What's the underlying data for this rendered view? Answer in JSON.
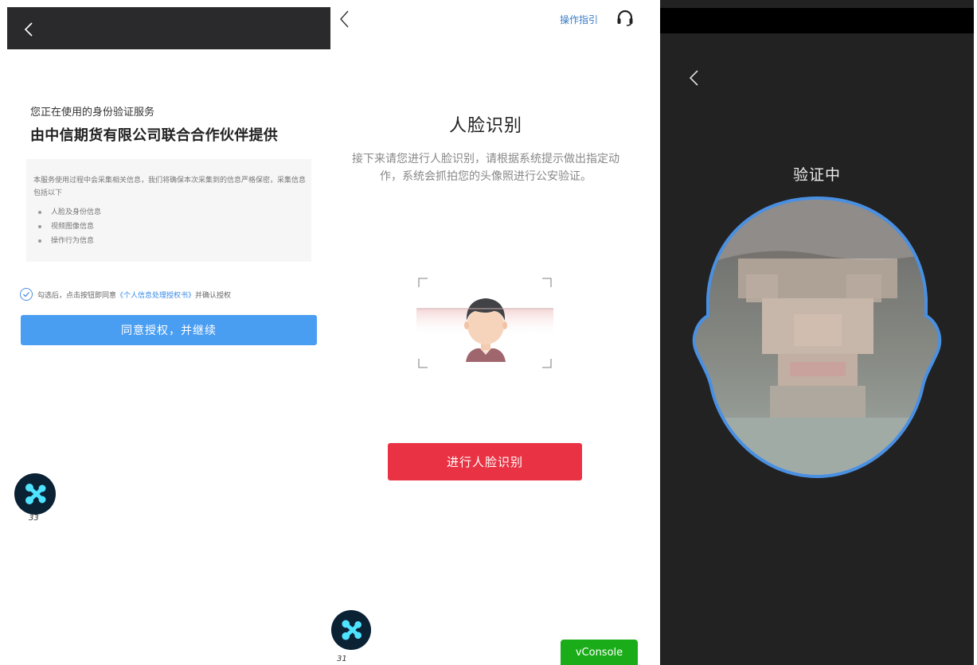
{
  "panel1": {
    "subtitle": "您正在使用的身份验证服务",
    "title": "由中信期货有限公司联合合作伙伴提供",
    "info_intro": "本服务使用过程中会采集相关信息，我们将确保本次采集到的信息严格保密，采集信息包括以下",
    "bullets": [
      "人脸及身份信息",
      "视频图像信息",
      "操作行为信息"
    ],
    "agree_prefix": "勾选后，点击按钮即同意",
    "agree_link": "《个人信息处理授权书》",
    "agree_suffix": "并确认授权",
    "button_label": "同意授权，并继续",
    "fab_count": "33"
  },
  "panel2": {
    "guide_label": "操作指引",
    "title": "人脸识别",
    "description": "接下来请您进行人脸识别，请根据系统提示做出指定动作，系统会抓拍您的头像照进行公安验证。",
    "button_label": "进行人脸识别",
    "fab_count": "31",
    "vconsole_label": "vConsole"
  },
  "panel3": {
    "title": "验证中"
  },
  "colors": {
    "primary_blue": "#4a9ef2",
    "link_blue": "#3a8bea",
    "primary_red": "#e93243",
    "vconsole_green": "#1aad19",
    "dark_bar": "#2a2a2c",
    "verify_bg": "#222222",
    "face_outline": "#4a90e2"
  }
}
